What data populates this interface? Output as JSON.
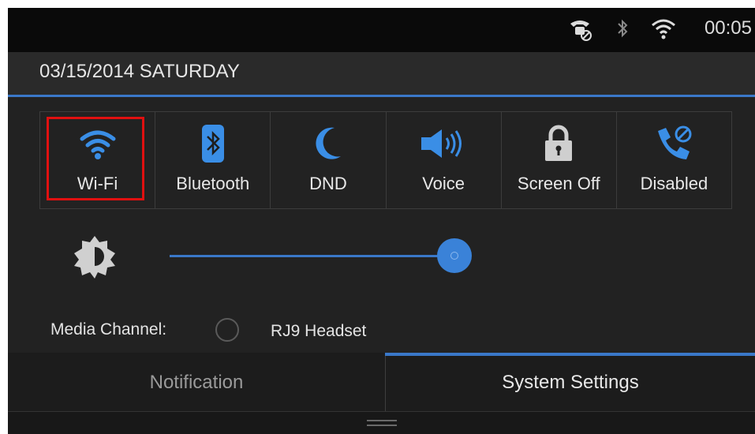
{
  "status_bar": {
    "time": "00:05",
    "icons": [
      "phone-muted-icon",
      "bluetooth-icon",
      "wifi-signal-icon"
    ]
  },
  "header": {
    "date": "03/15/2014 SATURDAY"
  },
  "quick_tiles": [
    {
      "label": "Wi-Fi",
      "icon": "wifi-icon",
      "highlighted": true
    },
    {
      "label": "Bluetooth",
      "icon": "bluetooth-icon"
    },
    {
      "label": "DND",
      "icon": "moon-icon"
    },
    {
      "label": "Voice",
      "icon": "speaker-icon"
    },
    {
      "label": "Screen Off",
      "icon": "lock-icon"
    },
    {
      "label": "Disabled",
      "icon": "phone-disabled-icon"
    }
  ],
  "brightness": {
    "icon": "brightness-icon",
    "level_fraction": 0.95
  },
  "media_channel": {
    "label": "Media Channel:",
    "option": "RJ9 Headset",
    "selected": false
  },
  "tabs": [
    {
      "label": "Notification",
      "active": false
    },
    {
      "label": "System Settings",
      "active": true
    }
  ],
  "colors": {
    "accent": "#3a78c9",
    "highlight": "#e01010",
    "icon_blue": "#3a8ee6"
  }
}
